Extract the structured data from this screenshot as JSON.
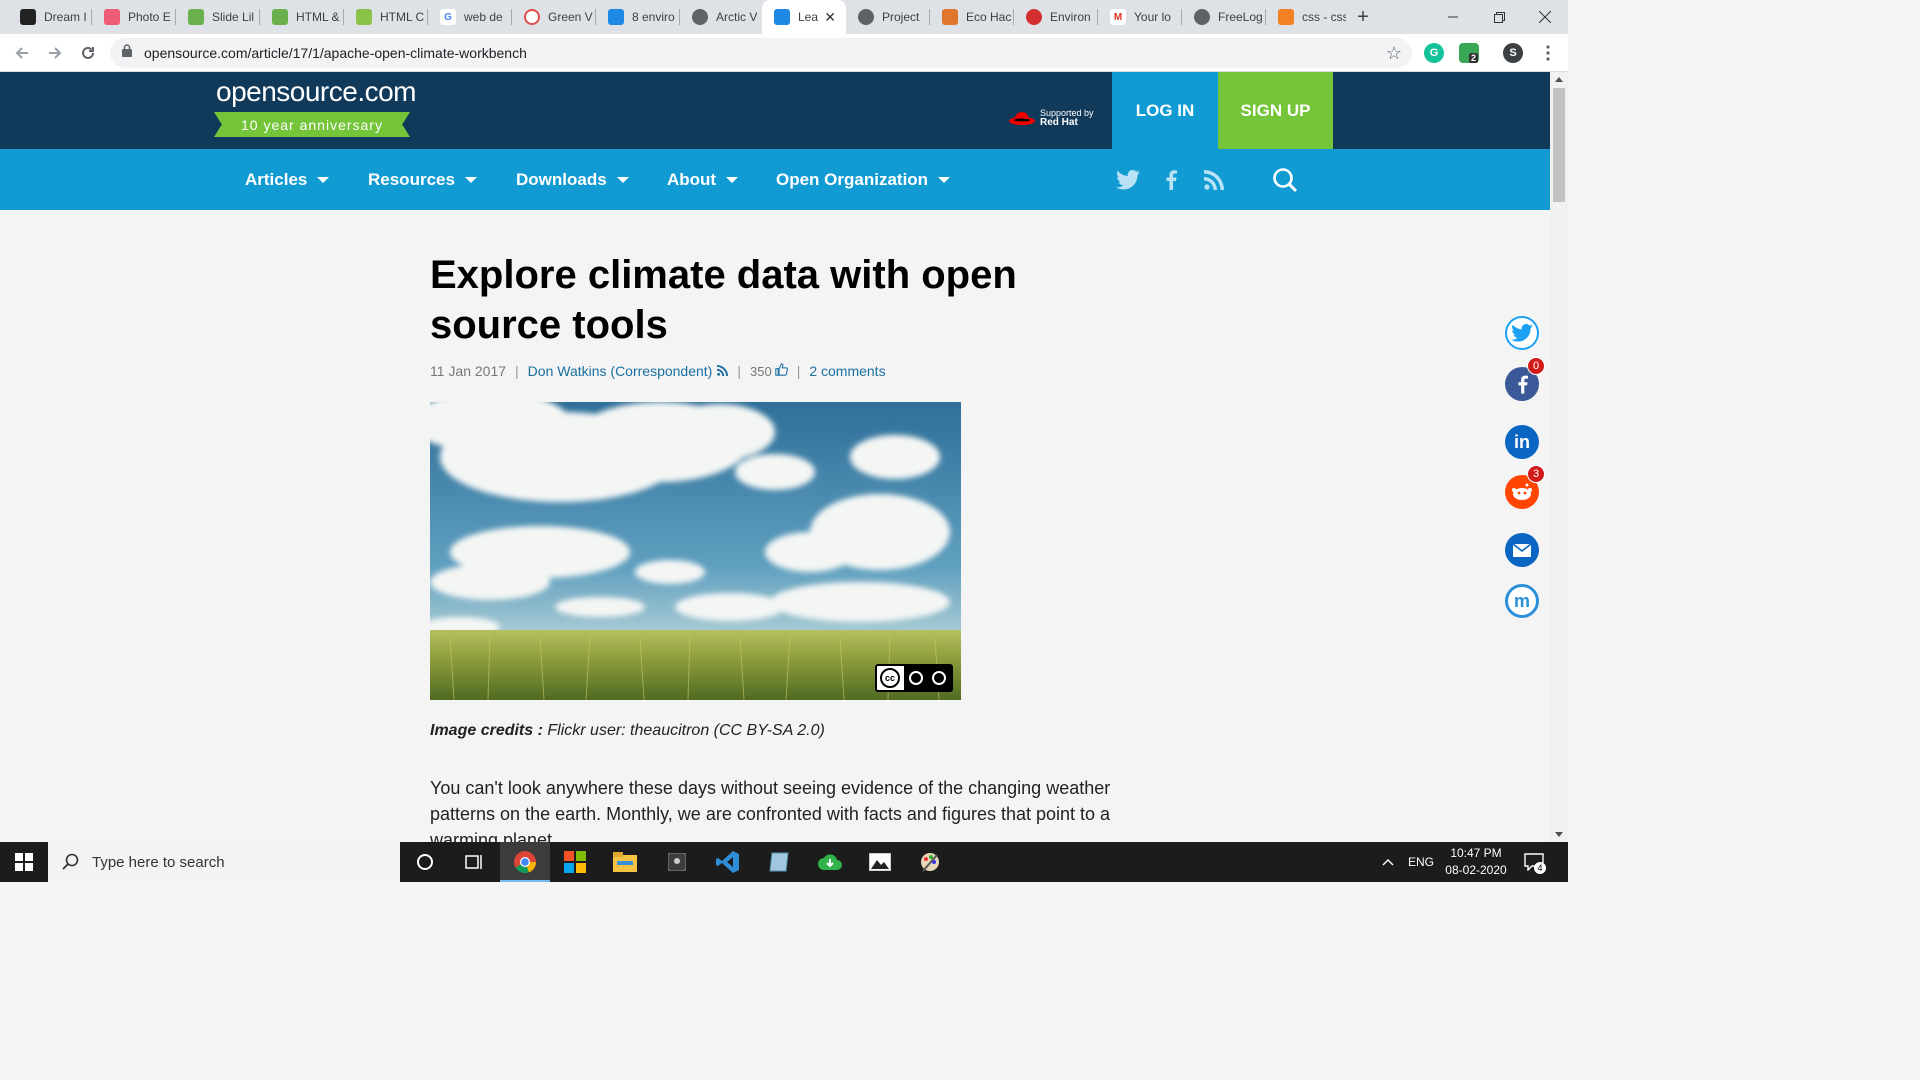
{
  "browser": {
    "tabs": [
      {
        "label": "Dream I",
        "color": "#222222"
      },
      {
        "label": "Photo E",
        "color": "#ef5a75"
      },
      {
        "label": "Slide Lil",
        "color": "#6ab04c"
      },
      {
        "label": "HTML &",
        "color": "#6ab04c"
      },
      {
        "label": "HTML C",
        "color": "#8bc34a"
      },
      {
        "label": "web de",
        "color": "#4285f4"
      },
      {
        "label": "Green V",
        "color": "#e24c4c"
      },
      {
        "label": "8 enviro",
        "color": "#1e88e5"
      },
      {
        "label": "Arctic V",
        "color": "#5f6368"
      },
      {
        "label": "Lea",
        "color": "#1e88e5"
      },
      {
        "label": "Project",
        "color": "#5f6368"
      },
      {
        "label": "Eco Hac",
        "color": "#e0752d"
      },
      {
        "label": "Environ",
        "color": "#d32f2f"
      },
      {
        "label": "Your lo",
        "color": "#d93025"
      },
      {
        "label": "FreeLog",
        "color": "#5f6368"
      },
      {
        "label": "css - css",
        "color": "#f48024"
      }
    ],
    "active_tab_index": 9,
    "new_tab_label": "+",
    "url": "opensource.com/article/17/1/apache-open-climate-workbench",
    "profile_initial": "S",
    "extension_badge": "2"
  },
  "header": {
    "logo": "opensource.com",
    "ribbon": "10 year anniversary",
    "supported_by": "Supported by",
    "sponsor": "Red Hat",
    "login": "LOG IN",
    "signup": "SIGN UP"
  },
  "nav": {
    "items": [
      "Articles",
      "Resources",
      "Downloads",
      "About",
      "Open Organization"
    ]
  },
  "article": {
    "title": "Explore climate data with open source tools",
    "date": "11 Jan 2017",
    "author": "Don Watkins (Correspondent)",
    "likes": "350",
    "comments": "2 comments",
    "credits_label": "Image credits :",
    "credits_text": " Flickr user: theaucitron (CC BY-SA 2.0)",
    "cc_label": "cc",
    "body": "You can't look anywhere these days without seeing evidence of the changing weather patterns on the earth. Monthly, we are confronted with facts and figures that point to a warming planet."
  },
  "share": {
    "facebook_count": "0",
    "reddit_count": "3"
  },
  "taskbar": {
    "search_placeholder": "Type here to search",
    "language": "ENG",
    "time": "10:47 PM",
    "date": "08-02-2020",
    "notification_count": "4"
  }
}
